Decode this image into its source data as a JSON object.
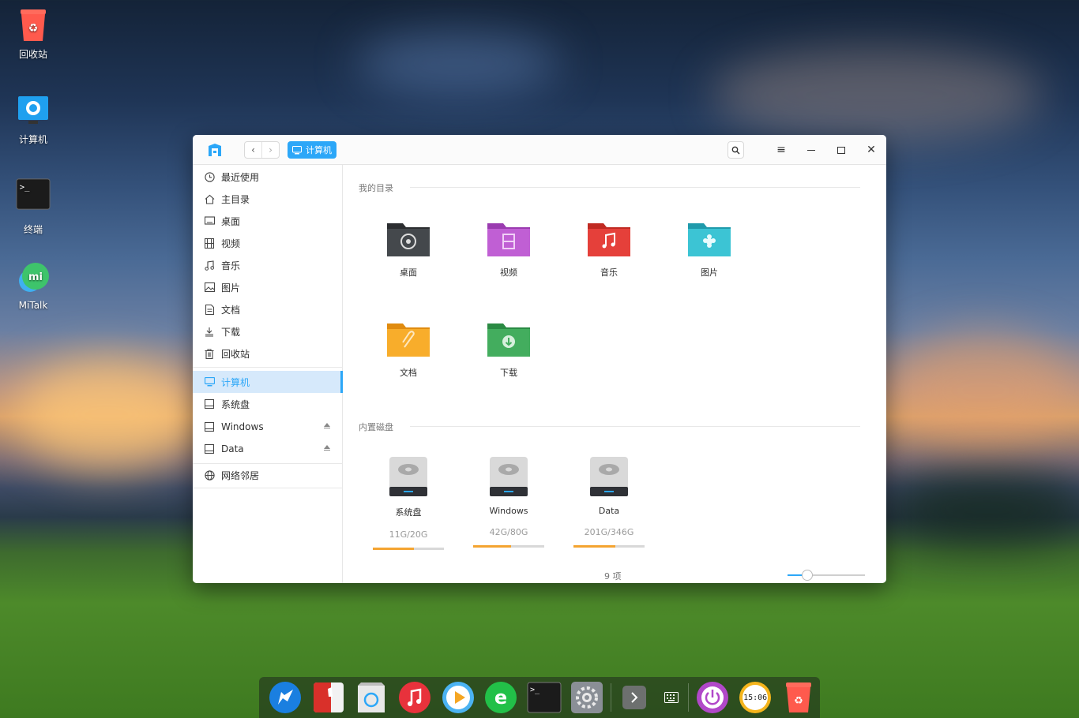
{
  "desktop": {
    "icons": [
      {
        "label": "回收站",
        "icon": "trash-icon"
      },
      {
        "label": "计算机",
        "icon": "computer-icon"
      },
      {
        "label": "终端",
        "icon": "terminal-icon"
      },
      {
        "label": "MiTalk",
        "icon": "mitalk-icon"
      }
    ]
  },
  "window": {
    "breadcrumb": "计算机",
    "sidebar": {
      "items": [
        {
          "label": "最近使用",
          "icon": "clock-icon"
        },
        {
          "label": "主目录",
          "icon": "home-icon"
        },
        {
          "label": "桌面",
          "icon": "desktop-icon"
        },
        {
          "label": "视频",
          "icon": "video-icon"
        },
        {
          "label": "音乐",
          "icon": "music-icon"
        },
        {
          "label": "图片",
          "icon": "picture-icon"
        },
        {
          "label": "文档",
          "icon": "document-icon"
        },
        {
          "label": "下载",
          "icon": "download-icon"
        },
        {
          "label": "回收站",
          "icon": "trash-icon"
        }
      ],
      "devices": [
        {
          "label": "计算机",
          "icon": "computer-icon",
          "active": true
        },
        {
          "label": "系统盘",
          "icon": "disk-icon"
        },
        {
          "label": "Windows",
          "icon": "disk-icon",
          "eject": true
        },
        {
          "label": "Data",
          "icon": "disk-icon",
          "eject": true
        }
      ],
      "network": {
        "label": "网络邻居",
        "icon": "network-icon"
      }
    },
    "my_dirs": {
      "title": "我的目录",
      "items": [
        {
          "label": "桌面",
          "icon": "desktop-folder-icon",
          "color": "#3a3d40"
        },
        {
          "label": "视频",
          "icon": "video-folder-icon",
          "color": "#b44fc6"
        },
        {
          "label": "音乐",
          "icon": "music-folder-icon",
          "color": "#e0382f"
        },
        {
          "label": "图片",
          "icon": "picture-folder-icon",
          "color": "#2db7c8"
        },
        {
          "label": "文档",
          "icon": "document-folder-icon",
          "color": "#f5a623"
        },
        {
          "label": "下载",
          "icon": "download-folder-icon",
          "color": "#3aa254"
        }
      ]
    },
    "disks": {
      "title": "内置磁盘",
      "items": [
        {
          "label": "系统盘",
          "size": "11G/20G",
          "usage": 0.58
        },
        {
          "label": "Windows",
          "size": "42G/80G",
          "usage": 0.53
        },
        {
          "label": "Data",
          "size": "201G/346G",
          "usage": 0.59
        }
      ]
    },
    "status": {
      "count": "9 项",
      "zoom": 0.25
    }
  },
  "dock": {
    "items": [
      "launcher-icon",
      "deepin-store-icon",
      "file-manager-icon",
      "music-app-icon",
      "video-player-icon",
      "browser-icon",
      "terminal-icon",
      "settings-icon",
      "expand-icon",
      "keyboard-icon",
      "power-icon",
      "clock-icon",
      "trash-icon"
    ],
    "clock_text": "15:06"
  },
  "colors": {
    "accent": "#2ca7f8",
    "usage_bar": "#f4a431"
  }
}
